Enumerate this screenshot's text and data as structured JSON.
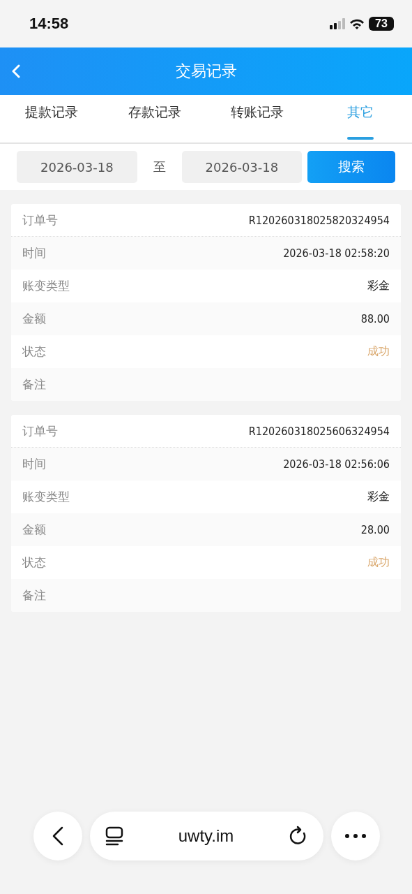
{
  "status_bar": {
    "time": "14:58",
    "battery": "73"
  },
  "header": {
    "title": "交易记录"
  },
  "tabs": [
    {
      "label": "提款记录",
      "selected": false
    },
    {
      "label": "存款记录",
      "selected": false
    },
    {
      "label": "转账记录",
      "selected": false
    },
    {
      "label": "其它",
      "selected": true
    }
  ],
  "filter": {
    "start_date": "2026-03-18",
    "separator": "至",
    "end_date": "2026-03-18",
    "search_button": "搜索"
  },
  "records": [
    {
      "rows": [
        {
          "kind": "text",
          "label": "订单号",
          "value": "R120260318025820324954"
        },
        {
          "kind": "text",
          "label": "时间",
          "value": "2026-03-18 02:58:20"
        },
        {
          "kind": "text",
          "label": "账变类型",
          "value": "彩金"
        },
        {
          "kind": "text",
          "label": "金额",
          "value": "88.00"
        },
        {
          "kind": "status",
          "label": "状态",
          "value": "成功"
        },
        {
          "kind": "text",
          "label": "备注"
        }
      ]
    },
    {
      "rows": [
        {
          "kind": "text",
          "label": "订单号",
          "value": "R120260318025606324954"
        },
        {
          "kind": "text",
          "label": "时间",
          "value": "2026-03-18 02:56:06"
        },
        {
          "kind": "text",
          "label": "账变类型",
          "value": "彩金"
        },
        {
          "kind": "text",
          "label": "金额",
          "value": "28.00"
        },
        {
          "kind": "status",
          "label": "状态",
          "value": "成功"
        },
        {
          "kind": "text",
          "label": "备注"
        }
      ]
    }
  ],
  "browser_bar": {
    "url": "uwty.im"
  }
}
